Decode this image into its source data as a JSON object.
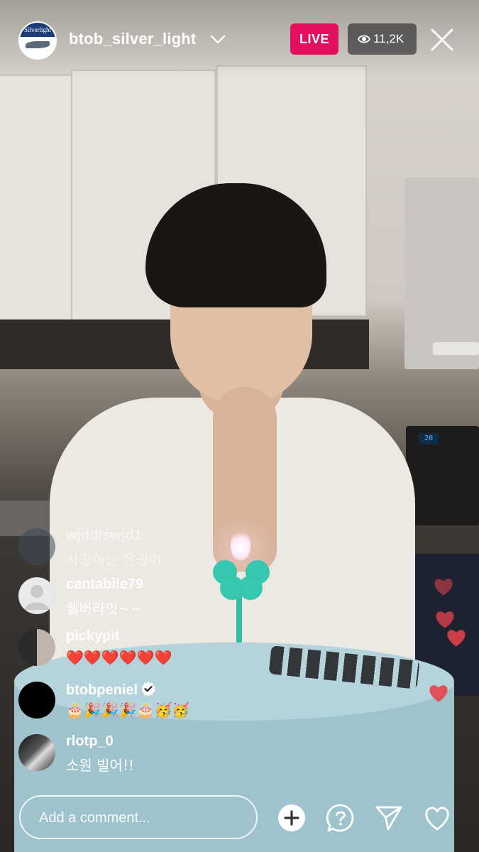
{
  "header": {
    "username": "btob_silver_light",
    "host_avatar_text": "Silverlight",
    "live_label": "LIVE",
    "viewer_count": "11,2K"
  },
  "scene": {
    "oven_display": "20"
  },
  "comments": [
    {
      "username": "wjddlswjd1",
      "text": "사랑하는 은광이",
      "faded": true
    },
    {
      "username": "cantabile79",
      "text": "쉘버라잇~~"
    },
    {
      "username": "pickypit",
      "text": "❤️❤️❤️❤️❤️❤️"
    },
    {
      "username": "btobpeniel",
      "text": "🎂🎉🎉🎉🎂🥳🥳",
      "verified": true
    },
    {
      "username": "rlotp_0",
      "text": "소원 빌어!!"
    }
  ],
  "composer": {
    "placeholder": "Add a comment..."
  },
  "icons": [
    "chevron-down-icon",
    "eye-icon",
    "close-icon",
    "plus-circle-icon",
    "question-bubble-icon",
    "send-icon",
    "heart-icon",
    "verified-icon"
  ],
  "colors": {
    "live_badge": "#E4105F",
    "floating_heart": "#E8434C"
  }
}
